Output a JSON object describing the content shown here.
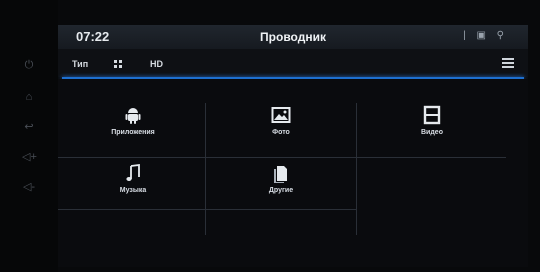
{
  "status_bar": {
    "time": "07:22",
    "title": "Проводник",
    "icons": "| ▣ ⚲"
  },
  "toolbar": {
    "tab_type": "Тип",
    "tab_hd": "HD"
  },
  "categories": [
    {
      "label": "Приложения",
      "icon": "android-icon"
    },
    {
      "label": "Фото",
      "icon": "image-icon"
    },
    {
      "label": "Видео",
      "icon": "film-icon"
    },
    {
      "label": "Музыка",
      "icon": "music-note-icon"
    },
    {
      "label": "Другие",
      "icon": "files-icon"
    }
  ],
  "side_buttons": {
    "power": "⏻",
    "home": "⌂",
    "back": "↩",
    "vol_up": "◁+",
    "vol_down": "◁-"
  },
  "colors": {
    "accent": "#1d6fd0",
    "background": "#0a0b0e",
    "text": "#e6eaee"
  }
}
